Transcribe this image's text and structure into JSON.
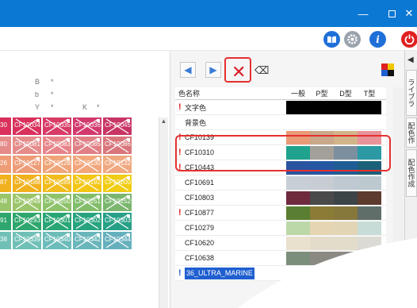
{
  "window": {
    "minimize": "—",
    "maximize": "",
    "close": "✕"
  },
  "toolbar": {
    "icons": [
      "book-icon",
      "gear-icon",
      "info-icon",
      "power-icon"
    ],
    "info_label": "i"
  },
  "left": {
    "ruler": [
      {
        "label": "B",
        "mark": "*"
      },
      {
        "label": "b",
        "mark": "*"
      },
      {
        "label": "Y",
        "mark": "*"
      },
      {
        "label": "K",
        "mark": "*"
      }
    ],
    "swatch_rows": [
      {
        "lead": "30",
        "items": [
          "CF10034",
          "CF10035",
          "CF10036",
          "CF10045"
        ],
        "colors": [
          "#d9305c",
          "#d83b66",
          "#d23a6d",
          "#c83565"
        ]
      },
      {
        "lead": "80",
        "items": [
          "CF10081",
          "CF10083",
          "CF10085",
          "CF10086"
        ],
        "colors": [
          "#e58c8a",
          "#e7858a",
          "#e07f85",
          "#d9767b"
        ]
      },
      {
        "lead": "26",
        "items": [
          "CF10127",
          "CF10128",
          "CF10130",
          "CF10132"
        ],
        "colors": [
          "#ee9c78",
          "#f0a579",
          "#f2a67b",
          "#f0a880"
        ]
      },
      {
        "lead": "87",
        "items": [
          "CF10188",
          "CF10189",
          "CF10192",
          "CF10200"
        ],
        "colors": [
          "#f1b11e",
          "#f2bc1e",
          "#f3c616",
          "#f0cc12"
        ]
      },
      {
        "lead": "48",
        "items": [
          "CF10249",
          "CF10250",
          "CF10251",
          "CF10252"
        ],
        "colors": [
          "#9bc56a",
          "#8ec26b",
          "#82bd6c",
          "#7bb670"
        ]
      },
      {
        "lead": "91",
        "items": [
          "CF10293",
          "CF10301",
          "CF10302",
          "CF10303"
        ],
        "colors": [
          "#2ea66d",
          "#2aa576",
          "#28a37f",
          "#27a087"
        ]
      },
      {
        "lead": "38",
        "items": [
          "CF10339",
          "CF10340",
          "CF10342",
          "CF10344"
        ],
        "colors": [
          "#70c0b7",
          "#6cbcb9",
          "#69b6bb",
          "#66b0bd"
        ]
      }
    ]
  },
  "panel": {
    "nav_prev": "◀",
    "nav_next": "▶",
    "delete": "✕",
    "eraser": "⌫",
    "columns": [
      "色名称",
      "一般",
      "P型",
      "D型",
      "T型"
    ],
    "rows": [
      {
        "flag": "!",
        "name": "文字色",
        "colors": [
          "#000000",
          "#000000",
          "#000000",
          "#000000"
        ]
      },
      {
        "flag": "",
        "name": "背景色",
        "colors": [
          "#ffffff",
          "#ffffff",
          "#ffffff",
          "#ffffff"
        ]
      },
      {
        "flag": "!",
        "name": "CF10139",
        "colors": [
          "#e99a77",
          "#c9a98a",
          "#d2b48a",
          "#e8939a"
        ]
      },
      {
        "flag": "!",
        "name": "CF10310",
        "colors": [
          "#1fa38f",
          "#a3a09a",
          "#7c8f9f",
          "#2b9aa5"
        ]
      },
      {
        "flag": "!",
        "name": "CF10443",
        "colors": [
          "#2a54a0",
          "#2557a3",
          "#1f5e94",
          "#1c6079"
        ]
      },
      {
        "flag": "",
        "name": "CF10691",
        "colors": [
          "#c7ced6",
          "#c8cdd4",
          "#bfc9d2",
          "#bcc9cf"
        ]
      },
      {
        "flag": "",
        "name": "CF10803",
        "colors": [
          "#6f2a3e",
          "#4a4a4a",
          "#3c4447",
          "#5d3b2e"
        ]
      },
      {
        "flag": "!",
        "name": "CF10877",
        "colors": [
          "#5b7f32",
          "#8a7b37",
          "#86773b",
          "#5f6e68"
        ]
      },
      {
        "flag": "",
        "name": "CF10279",
        "colors": [
          "#bcd8a8",
          "#e6d5b2",
          "#e2d5b5",
          "#c7dcd6"
        ]
      },
      {
        "flag": "",
        "name": "CF10620",
        "colors": [
          "#e9e1ce",
          "#e3dccb",
          "#e2dcca",
          "#dcdad4"
        ]
      },
      {
        "flag": "",
        "name": "CF10638",
        "colors": [
          "#7b8e7b",
          "#8b8a82",
          "#8c8a82",
          "#7e8c8c"
        ]
      },
      {
        "flag": "!",
        "name": "36_ULTRA_MARINE",
        "colors": [
          "",
          "",
          "",
          ""
        ],
        "selected": true
      }
    ]
  },
  "side": {
    "arrow": "◀",
    "tabs": [
      "ライブラ",
      "配色作",
      "配色作成"
    ]
  }
}
